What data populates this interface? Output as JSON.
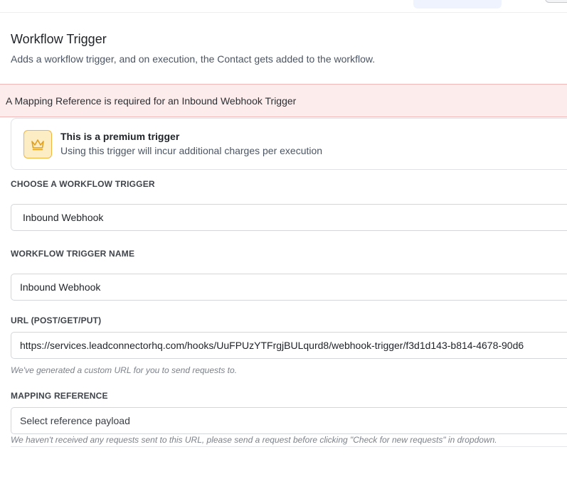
{
  "panel": {
    "title": "Workflow Trigger",
    "subtitle": "Adds a workflow trigger, and on execution, the Contact gets added to the workflow."
  },
  "alert": {
    "message": "A Mapping Reference is required for an Inbound Webhook Trigger",
    "color": "#fdecec"
  },
  "premium": {
    "icon": "crown-icon",
    "title": "This is a premium trigger",
    "description": "Using this trigger will incur additional charges per execution"
  },
  "trigger_select": {
    "label": "CHOOSE A WORKFLOW TRIGGER",
    "value": "Inbound Webhook"
  },
  "trigger_name": {
    "label": "WORKFLOW TRIGGER NAME",
    "value": "Inbound Webhook"
  },
  "url": {
    "label": "URL (POST/GET/PUT)",
    "value": "https://services.leadconnectorhq.com/hooks/UuFPUzYTFrgjBULqurd8/webhook-trigger/f3d1d143-b814-4678-90d6",
    "hint": "We've generated a custom URL for you to send requests to."
  },
  "mapping": {
    "label": "MAPPING REFERENCE",
    "placeholder": "Select reference payload",
    "hint": "We haven't received any requests sent to this URL, please send a request before clicking \"Check for new requests\" in dropdown."
  }
}
